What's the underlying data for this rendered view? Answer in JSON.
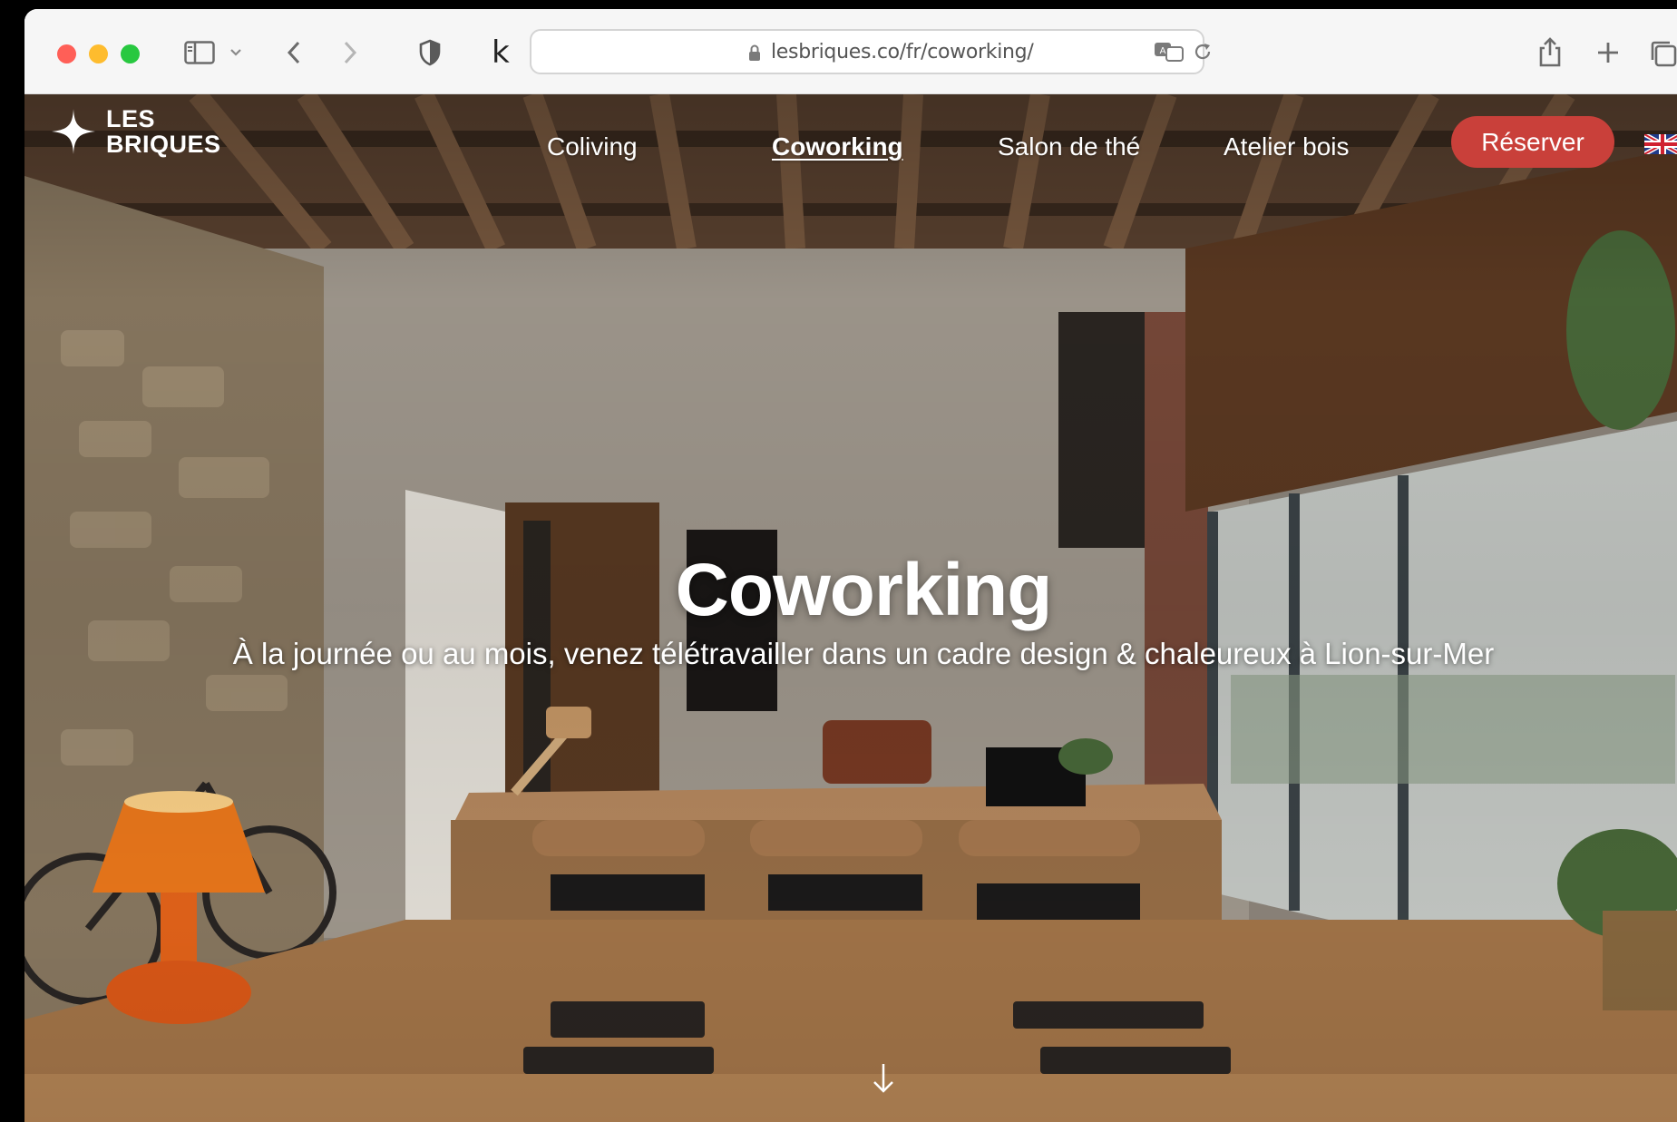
{
  "browser": {
    "url": "lesbriques.co/fr/coworking/",
    "icons": {
      "sidebar": "sidebar-icon",
      "back": "chevron-left-icon",
      "forward": "chevron-right-icon",
      "privacy": "shield-icon",
      "extension": "k-icon",
      "lock": "lock-icon",
      "translate": "translate-icon",
      "reload": "reload-icon",
      "share": "share-icon",
      "new_tab": "plus-icon",
      "tabs": "tabs-overview-icon"
    },
    "extension_label": "k"
  },
  "site": {
    "logo": {
      "line1": "LES",
      "line2": "BRIQUES"
    },
    "nav": {
      "items": [
        {
          "label": "Coliving",
          "active": false
        },
        {
          "label": "Coworking",
          "active": true
        },
        {
          "label": "Salon de thé",
          "active": false
        },
        {
          "label": "Atelier bois",
          "active": false
        }
      ],
      "cta_label": "Réserver",
      "language_icon": "uk-flag-icon"
    }
  },
  "hero": {
    "title": "Coworking",
    "subtitle": "À la journée ou au mois, venez télétravailler dans un cadre design & chaleureux à Lion-sur-Mer",
    "scroll_icon": "arrow-down-icon"
  },
  "colors": {
    "cta": "#c9403a",
    "text_on_photo": "#ffffff",
    "toolbar": "#f6f6f6"
  }
}
